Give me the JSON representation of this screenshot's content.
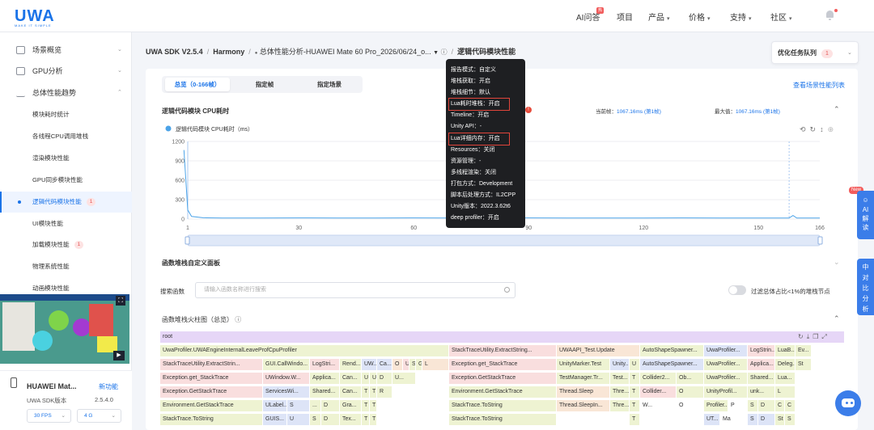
{
  "header": {
    "logo_text": "UWA",
    "logo_tagline": "MAKE IT SIMPLE",
    "nav": [
      {
        "label": "AI问答",
        "has_arrow": false
      },
      {
        "label": "项目",
        "has_arrow": false
      },
      {
        "label": "产品",
        "has_arrow": true
      },
      {
        "label": "价格",
        "has_arrow": true
      },
      {
        "label": "支持",
        "has_arrow": true
      },
      {
        "label": "社区",
        "has_arrow": true
      }
    ],
    "ai_badge": "热"
  },
  "sidebar": {
    "top_items": [
      {
        "label": "场景概览"
      },
      {
        "label": "GPU分析"
      },
      {
        "label": "总体性能趋势"
      }
    ],
    "sub_items": [
      {
        "label": "模块耗时统计",
        "badge": ""
      },
      {
        "label": "各线程CPU调用堆栈",
        "badge": ""
      },
      {
        "label": "渲染模块性能",
        "badge": ""
      },
      {
        "label": "GPU同步模块性能",
        "badge": ""
      },
      {
        "label": "逻辑代码模块性能",
        "badge": "1"
      },
      {
        "label": "UI模块性能",
        "badge": ""
      },
      {
        "label": "加载模块性能",
        "badge": "1"
      },
      {
        "label": "物理系统性能",
        "badge": ""
      },
      {
        "label": "动画模块性能",
        "badge": ""
      }
    ],
    "device": {
      "name": "HUAWEI Mat...",
      "new_feature": "新功能",
      "sdk_label": "UWA SDK版本",
      "sdk_value": "2.5.4.0",
      "fps": "30 FPS",
      "mem": "4 G"
    }
  },
  "breadcrumb": {
    "sdk": "UWA SDK V2.5.4",
    "platform": "Harmony",
    "report": "总体性能分析-HUAWEI Mate 60 Pro_2026/06/24_o...",
    "current": "逻辑代码模块性能"
  },
  "queue": {
    "label": "优化任务队列",
    "count": "1"
  },
  "tabs": [
    {
      "label": "总览（0-166帧）",
      "active": true
    },
    {
      "label": "指定帧",
      "active": false
    },
    {
      "label": "指定场景",
      "active": false
    }
  ],
  "scene_link": "查看场景性能列表",
  "chart_section": {
    "title": "逻辑代码模块 CPU耗时",
    "current_label": "当前帧：",
    "current_value": "1067.16ms (第1帧)",
    "max_label": "最大值：",
    "max_value": "1067.16ms (第1帧)"
  },
  "chart_data": {
    "type": "line",
    "series": [
      {
        "name": "逻辑代码模块 CPU耗时（ms）",
        "color": "#4ba3e8"
      }
    ],
    "x": [
      0,
      1,
      2,
      5,
      10,
      20,
      30,
      40,
      50,
      60,
      70,
      79,
      80,
      81,
      90,
      100,
      110,
      120,
      130,
      140,
      150,
      158,
      159,
      160,
      166
    ],
    "y": [
      1067,
      140,
      40,
      20,
      15,
      15,
      18,
      15,
      15,
      18,
      16,
      15,
      60,
      15,
      17,
      15,
      16,
      15,
      17,
      15,
      16,
      15,
      55,
      15,
      15
    ],
    "xticks": [
      1,
      30,
      60,
      90,
      120,
      150,
      166
    ],
    "yticks": [
      0,
      300,
      600,
      900,
      1200
    ],
    "xlim": [
      1,
      166
    ],
    "ylim": [
      0,
      1200
    ],
    "grid": true,
    "legend": "top-left"
  },
  "stack_section": {
    "title": "函数堆栈自定义面板",
    "search_label": "搜索函数",
    "search_placeholder": "请输入函数名称进行搜索",
    "filter_label": "过滤总体占比<1%的堆栈节点",
    "flame_title": "函数堆栈火柱图（总览）"
  },
  "flame_rows": [
    [
      {
        "t": "root",
        "w": 846,
        "c": "#e6d6f7"
      }
    ],
    [
      {
        "t": "UwaProfiler.UWAEngineInternalLeaveProfCpuProfiler",
        "w": 357,
        "c": "#eef3d2"
      },
      {
        "t": "StackTraceUtility.ExtractString...",
        "w": 133,
        "c": "#f9dede"
      },
      {
        "t": "UWAAPI_Test.Update",
        "w": 103,
        "c": "#f9e6d6"
      },
      {
        "t": "AutoShapeSpawner...",
        "w": 79,
        "c": "#eef3d2"
      },
      {
        "t": "UwaProfiler...",
        "w": 54,
        "c": "#dde4f7"
      },
      {
        "t": "LogStrin...",
        "w": 34,
        "c": "#f9dede"
      },
      {
        "t": "LuaB...",
        "w": 25,
        "c": "#eef3d2"
      },
      {
        "t": "Ev...",
        "w": 20,
        "c": "#eef3d2"
      }
    ],
    [
      {
        "t": "StackTraceUtility.ExtractStrin...",
        "w": 127,
        "c": "#f9dede"
      },
      {
        "t": "GUI.CallWindo...",
        "w": 58,
        "c": "#eef3d2"
      },
      {
        "t": "LogStri...",
        "w": 37,
        "c": "#f9dede"
      },
      {
        "t": "Rend...",
        "w": 27,
        "c": "#eef3d2"
      },
      {
        "t": "UW...",
        "w": 19,
        "c": "#dde4f7"
      },
      {
        "t": "Ca...",
        "w": 19,
        "c": "#dde4f7"
      },
      {
        "t": "O",
        "w": 13,
        "c": "#f9e6d6"
      },
      {
        "t": "U",
        "w": 8,
        "c": "#f9dede"
      },
      {
        "t": "S",
        "w": 8,
        "c": "#eef3d2"
      },
      {
        "t": "G",
        "w": 8,
        "c": "#eef3d2"
      },
      {
        "t": "L",
        "w": 33,
        "c": "#f9e6d6"
      },
      {
        "t": "Exception.get_StackTrace",
        "w": 133,
        "c": "#f9dede"
      },
      {
        "t": "UnityMarker.Test",
        "w": 66,
        "c": "#eef3d2"
      },
      {
        "t": "Unity...",
        "w": 24,
        "c": "#dde4f7"
      },
      {
        "t": "U",
        "w": 13,
        "c": "#eef3d2"
      },
      {
        "t": "AutoShapeSpawner...",
        "w": 79,
        "c": "#dde4f7"
      },
      {
        "t": "UwaProfiler...",
        "w": 54,
        "c": "#eef3d2"
      },
      {
        "t": "Applica...",
        "w": 34,
        "c": "#f9dede"
      },
      {
        "t": "Deleg...",
        "w": 25,
        "c": "#eef3d2"
      },
      {
        "t": "St",
        "w": 20,
        "c": "#eef3d2"
      }
    ],
    [
      {
        "t": "Exception.get_StackTrace",
        "w": 127,
        "c": "#f9dede"
      },
      {
        "t": "UWindow.W...",
        "w": 58,
        "c": "#f9dede"
      },
      {
        "t": "Applica...",
        "w": 37,
        "c": "#eef3d2"
      },
      {
        "t": "Can...",
        "w": 27,
        "c": "#eef3d2"
      },
      {
        "t": "U",
        "w": 10,
        "c": "#eef3d2"
      },
      {
        "t": "U",
        "w": 9,
        "c": "#eef3d2"
      },
      {
        "t": "D",
        "w": 19,
        "c": "#eef3d2"
      },
      {
        "t": "U...",
        "w": 29,
        "c": "#eef3d2"
      },
      {
        "t": "",
        "w": 41,
        "c": "#ffffff"
      },
      {
        "t": "Exception.GetStackTrace",
        "w": 133,
        "c": "#f9dede"
      },
      {
        "t": "TestManager.Tr...",
        "w": 66,
        "c": "#eef3d2"
      },
      {
        "t": "Test...",
        "w": 24,
        "c": "#eef3d2"
      },
      {
        "t": "T",
        "w": 13,
        "c": "#eef3d2"
      },
      {
        "t": "Collider2...",
        "w": 45,
        "c": "#eef3d2"
      },
      {
        "t": "Ob...",
        "w": 34,
        "c": "#eef3d2"
      },
      {
        "t": "UwaProfiler...",
        "w": 54,
        "c": "#eef3d2"
      },
      {
        "t": "Shared...",
        "w": 34,
        "c": "#eef3d2"
      },
      {
        "t": "Lua...",
        "w": 25,
        "c": "#eef3d2"
      }
    ],
    [
      {
        "t": "Exception.GetStackTrace",
        "w": 127,
        "c": "#f9dede"
      },
      {
        "t": "ServicesWi...",
        "w": 58,
        "c": "#dde4f7"
      },
      {
        "t": "Shared...",
        "w": 37,
        "c": "#eef3d2"
      },
      {
        "t": "Can...",
        "w": 27,
        "c": "#eef3d2"
      },
      {
        "t": "T",
        "w": 10,
        "c": "#eef3d2"
      },
      {
        "t": "T",
        "w": 9,
        "c": "#eef3d2"
      },
      {
        "t": "R",
        "w": 19,
        "c": "#eef3d2"
      },
      {
        "t": "",
        "w": 70,
        "c": "#ffffff"
      },
      {
        "t": "Environment.GetStackTrace",
        "w": 133,
        "c": "#eef3d2"
      },
      {
        "t": "Thread.Sleep",
        "w": 66,
        "c": "#f9e6d6"
      },
      {
        "t": "Thre...",
        "w": 24,
        "c": "#eef3d2"
      },
      {
        "t": "T",
        "w": 13,
        "c": "#eef3d2"
      },
      {
        "t": "Collider...",
        "w": 45,
        "c": "#f9dede"
      },
      {
        "t": "O",
        "w": 34,
        "c": "#eef3d2"
      },
      {
        "t": "UnityProfil...",
        "w": 54,
        "c": "#eef3d2"
      },
      {
        "t": "unk...",
        "w": 34,
        "c": "#eef3d2"
      },
      {
        "t": "L",
        "w": 25,
        "c": "#eef3d2"
      }
    ],
    [
      {
        "t": "Environment.GetStackTrace",
        "w": 127,
        "c": "#eef3d2"
      },
      {
        "t": "ULabel...",
        "w": 30,
        "c": "#dde4f7"
      },
      {
        "t": "S",
        "w": 28,
        "c": "#dde4f7"
      },
      {
        "t": "...",
        "w": 14,
        "c": "#eef3d2"
      },
      {
        "t": "D",
        "w": 23,
        "c": "#eef3d2"
      },
      {
        "t": "Gra...",
        "w": 27,
        "c": "#eef3d2"
      },
      {
        "t": "T",
        "w": 10,
        "c": "#eef3d2"
      },
      {
        "t": "T",
        "w": 9,
        "c": "#eef3d2"
      },
      {
        "t": "",
        "w": 89,
        "c": "#ffffff"
      },
      {
        "t": "StackTrace.ToString",
        "w": 133,
        "c": "#eef3d2"
      },
      {
        "t": "Thread.SleepIn...",
        "w": 66,
        "c": "#f9e6d6"
      },
      {
        "t": "Thre...",
        "w": 24,
        "c": "#eef3d2"
      },
      {
        "t": "T",
        "w": 13,
        "c": "#eef3d2"
      },
      {
        "t": "W...",
        "w": 45,
        "c": "#ffffff"
      },
      {
        "t": "O",
        "w": 34,
        "c": "#ffffff"
      },
      {
        "t": "Profiler...",
        "w": 30,
        "c": "#eef3d2"
      },
      {
        "t": "P",
        "w": 24,
        "c": "#ffffff"
      },
      {
        "t": "S",
        "w": 13,
        "c": "#eef3d2"
      },
      {
        "t": "D",
        "w": 21,
        "c": "#eef3d2"
      },
      {
        "t": "C",
        "w": 12,
        "c": "#eef3d2"
      },
      {
        "t": "C",
        "w": 13,
        "c": "#eef3d2"
      }
    ],
    [
      {
        "t": "StackTrace.ToString",
        "w": 127,
        "c": "#eef3d2"
      },
      {
        "t": "GUIS...",
        "w": 30,
        "c": "#dde4f7"
      },
      {
        "t": "U",
        "w": 28,
        "c": "#dde4f7"
      },
      {
        "t": "S",
        "w": 14,
        "c": "#eef3d2"
      },
      {
        "t": "D",
        "w": 23,
        "c": "#eef3d2"
      },
      {
        "t": "Tex...",
        "w": 27,
        "c": "#eef3d2"
      },
      {
        "t": "T",
        "w": 10,
        "c": "#eef3d2"
      },
      {
        "t": "T",
        "w": 9,
        "c": "#eef3d2"
      },
      {
        "t": "",
        "w": 89,
        "c": "#ffffff"
      },
      {
        "t": "StackTrace.ToString",
        "w": 133,
        "c": "#eef3d2"
      },
      {
        "t": "",
        "w": 90,
        "c": "#ffffff"
      },
      {
        "t": "T",
        "w": 13,
        "c": "#eef3d2"
      },
      {
        "t": "",
        "w": 79,
        "c": "#ffffff"
      },
      {
        "t": "UT...",
        "w": 20,
        "c": "#dde4f7"
      },
      {
        "t": "Ma",
        "w": 34,
        "c": "#ffffff"
      },
      {
        "t": "S",
        "w": 13,
        "c": "#dde4f7"
      },
      {
        "t": "D",
        "w": 21,
        "c": "#dde4f7"
      },
      {
        "t": "St",
        "w": 12,
        "c": "#eef3d2"
      },
      {
        "t": "S",
        "w": 13,
        "c": "#eef3d2"
      }
    ]
  ],
  "tooltip": {
    "lines": [
      "报告模式：自定义",
      "堆栈获取：开启",
      "堆栈细节：默认",
      "Lua耗时堆栈：开启",
      "Timeline：开启",
      "Unity API：-",
      "Lua详细内存：开启",
      "Resources：关闭",
      "资源管理：-",
      "多线程渲染：关闭",
      "打包方式：Development",
      "脚本后处理方式：IL2CPP",
      "Unity版本：2022.3.62t6",
      "deep profiler：开启"
    ],
    "highlighted": [
      3,
      6
    ]
  },
  "right_tabs": {
    "new_badge": "New",
    "ai": "AI解读",
    "compare": "中对比分析"
  }
}
